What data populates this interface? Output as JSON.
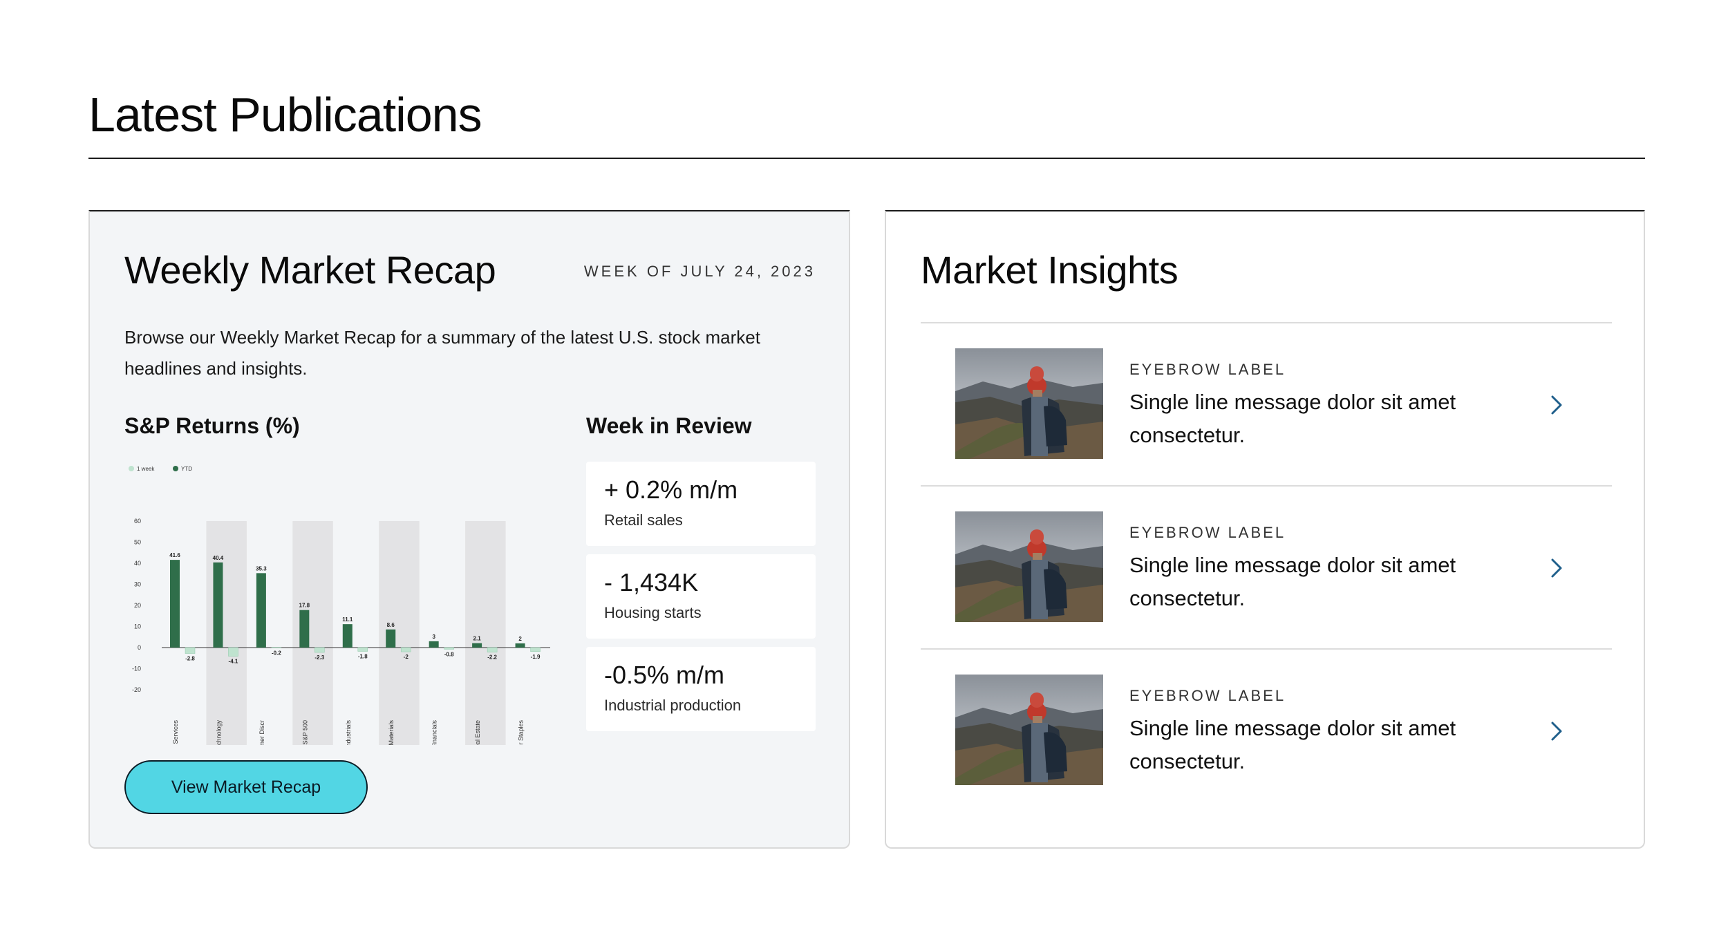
{
  "page": {
    "title": "Latest Publications"
  },
  "recap": {
    "title": "Weekly Market Recap",
    "week": "WEEK OF JULY 24, 2023",
    "description": "Browse our Weekly Market Recap for a summary of the latest U.S. stock market headlines and insights.",
    "chart_heading": "S&P Returns (%)",
    "cta_label": "View Market Recap"
  },
  "chart_data": {
    "type": "bar",
    "title": "S&P Returns (%)",
    "categories": [
      "Comm Services",
      "Technology",
      "Consumer Discr",
      "S&P 500",
      "Industrials",
      "Materials",
      "Financials",
      "Real Estate",
      "Consumer Staples"
    ],
    "series": [
      {
        "name": "1 week",
        "values": [
          -2.8,
          -4.1,
          -0.2,
          -2.3,
          -1.8,
          -2,
          -0.8,
          -2.2,
          -1.9
        ],
        "color": "#bfe3cf"
      },
      {
        "name": "YTD",
        "values": [
          41.6,
          40.4,
          35.3,
          17.8,
          11.1,
          8.6,
          3,
          2.1,
          2
        ],
        "color": "#2f6e4a"
      }
    ],
    "data_labels": {
      "YTD": [
        "41.6",
        "40.4",
        "35.3",
        "17.8",
        "11.1",
        "8.6",
        "3",
        "2.1",
        "2"
      ],
      "1 week": [
        "-2.8",
        "-4.1",
        "-0.2",
        "-2.3",
        "-1.8",
        "-2",
        "-0.8",
        "-2.2",
        "-1.9"
      ]
    },
    "y_ticks": [
      "60",
      "50",
      "40",
      "30",
      "20",
      "10",
      "0",
      "-10",
      "-20"
    ],
    "ylim": [
      -20,
      60
    ],
    "legend_position": "top-left",
    "shaded_categories": [
      "Technology",
      "S&P 500",
      "Materials",
      "Real Estate"
    ]
  },
  "week_in_review": {
    "heading": "Week in Review",
    "stats": [
      {
        "value": "+ 0.2% m/m",
        "label": "Retail sales"
      },
      {
        "value": "- 1,434K",
        "label": "Housing starts"
      },
      {
        "value": "-0.5% m/m",
        "label": "Industrial production"
      }
    ]
  },
  "insights": {
    "title": "Market Insights",
    "items": [
      {
        "eyebrow": "EYEBROW LABEL",
        "message": "Single line message dolor sit amet consectetur.",
        "icon": "chevron-right-icon"
      },
      {
        "eyebrow": "EYEBROW LABEL",
        "message": "Single line message dolor sit amet consectetur.",
        "icon": "chevron-right-icon"
      },
      {
        "eyebrow": "EYEBROW LABEL",
        "message": "Single line message dolor sit amet consectetur.",
        "icon": "chevron-right-icon"
      }
    ]
  },
  "colors": {
    "accent": "#52d6e4",
    "ytd_bar": "#2f6e4a",
    "week_bar": "#bfe3cf",
    "shade_band": "#e3e3e5"
  }
}
